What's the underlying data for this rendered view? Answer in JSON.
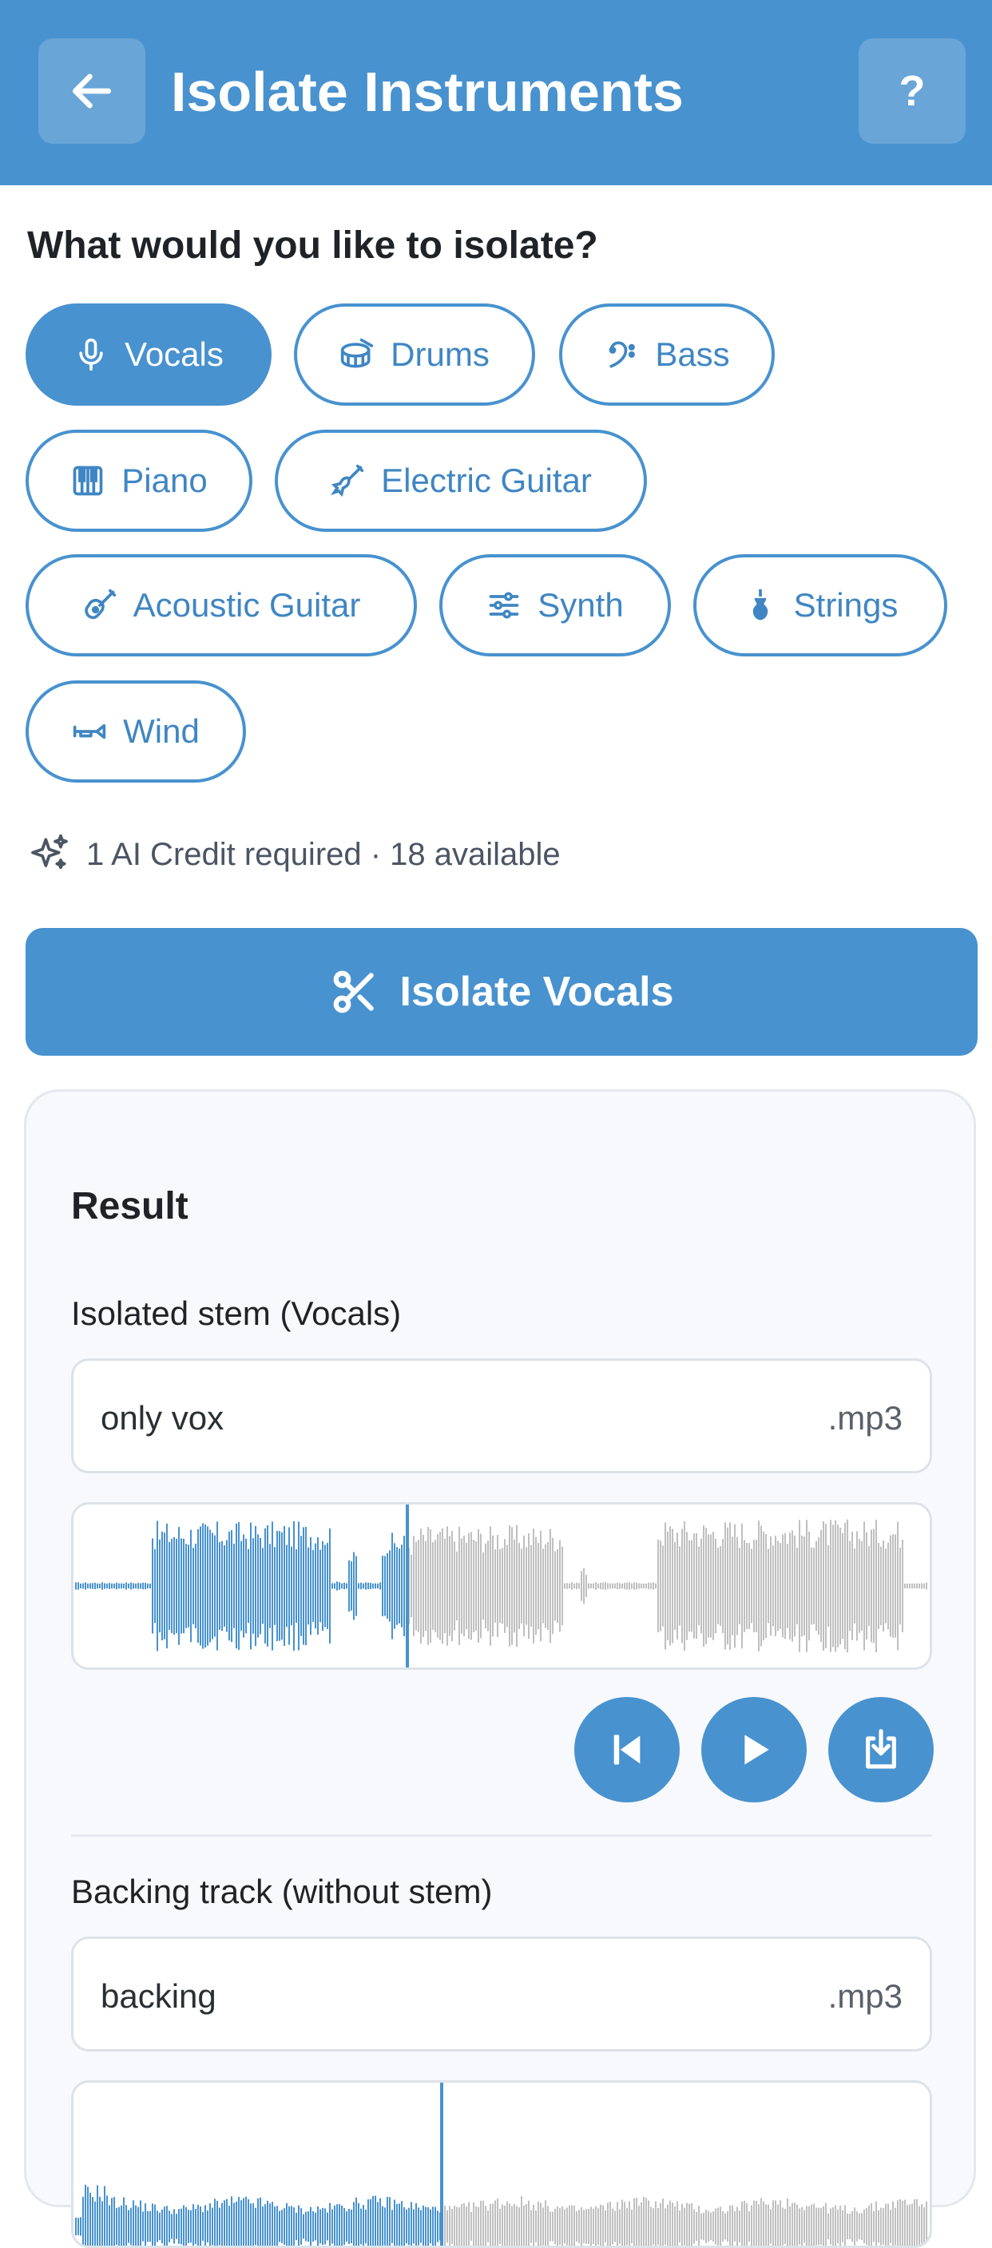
{
  "header": {
    "title": "Isolate Instruments",
    "help_label": "?"
  },
  "prompt": "What would you like to isolate?",
  "chips": [
    {
      "label": "Vocals",
      "icon": "mic-icon",
      "selected": true
    },
    {
      "label": "Drums",
      "icon": "drum-icon",
      "selected": false
    },
    {
      "label": "Bass",
      "icon": "bass-clef-icon",
      "selected": false
    },
    {
      "label": "Piano",
      "icon": "piano-icon",
      "selected": false
    },
    {
      "label": "Electric Guitar",
      "icon": "electric-guitar-icon",
      "selected": false
    },
    {
      "label": "Acoustic Guitar",
      "icon": "acoustic-guitar-icon",
      "selected": false
    },
    {
      "label": "Synth",
      "icon": "sliders-icon",
      "selected": false
    },
    {
      "label": "Strings",
      "icon": "violin-icon",
      "selected": false
    },
    {
      "label": "Wind",
      "icon": "trumpet-icon",
      "selected": false
    }
  ],
  "credits_text": "1 AI Credit required · 18 available",
  "isolate_button": "Isolate Vocals",
  "result": {
    "title": "Result",
    "stem": {
      "label": "Isolated stem (Vocals)",
      "file_name": "only vox",
      "file_ext": ".mp3",
      "progress": 0.39
    },
    "backing": {
      "label": "Backing track (without stem)",
      "file_name": "backing",
      "file_ext": ".mp3",
      "progress": 0.43
    }
  },
  "colors": {
    "accent": "#4892cf",
    "wave_played": "#4892cf",
    "wave_unplayed": "#bfbfbf"
  }
}
